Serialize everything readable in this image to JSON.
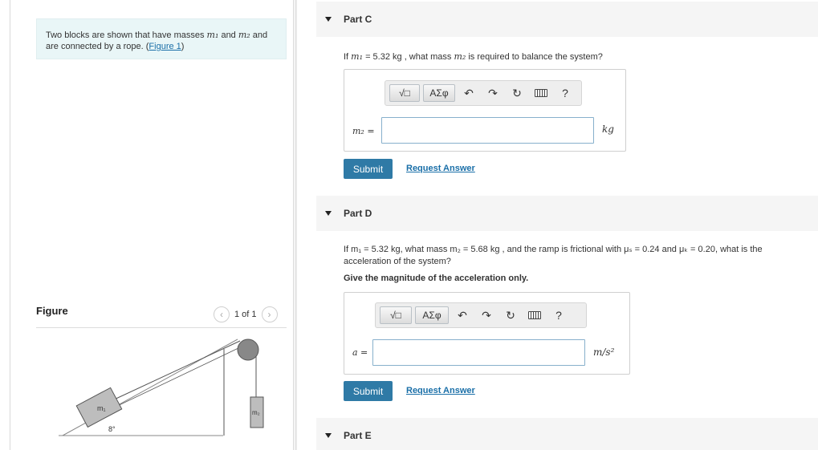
{
  "intro": {
    "text_before": "Two blocks are shown that have masses ",
    "m1": "m₁",
    "text_and": " and ",
    "m2": "m₂",
    "text_after": " and are connected by a rope. (",
    "figure_link": "Figure 1",
    "close_paren": ")"
  },
  "figure": {
    "label": "Figure",
    "pager_text": "1 of 1",
    "prev_icon": "chevron-left-icon",
    "next_icon": "chevron-right-icon",
    "block1_label": "m₁",
    "block2_label": "m₂",
    "angle_label": "8°"
  },
  "toolbar": {
    "template_label": "√□",
    "greek_label": "ΑΣφ",
    "undo_icon": "undo-icon",
    "redo_icon": "redo-icon",
    "reset_icon": "reset-icon",
    "keyboard_icon": "keyboard-icon",
    "help_label": "?"
  },
  "partC": {
    "title": "Part C",
    "question_prefix": "If ",
    "m1": "m₁",
    "question_value": " = 5.32  kg , what mass ",
    "m2": "m₂",
    "question_suffix": " is required to balance the system?",
    "var_label": "m₂ =",
    "input_value": "",
    "unit": "kg",
    "submit_label": "Submit",
    "request_label": "Request Answer"
  },
  "partD": {
    "title": "Part D",
    "q_line1": "If m₁ = 5.32 kg, what mass m₂ = 5.68  kg , and the ramp is frictional with μₛ = 0.24 and μₖ = 0.20, what is the",
    "q_line2": "acceleration of the system?",
    "instruction": "Give the magnitude of the acceleration only.",
    "var_label": "a =",
    "input_value": "",
    "unit": "m/s²",
    "submit_label": "Submit",
    "request_label": "Request Answer"
  },
  "partE": {
    "title": "Part E"
  }
}
